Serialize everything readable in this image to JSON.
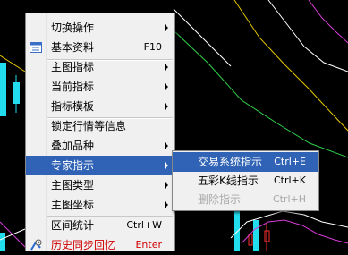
{
  "colors": {
    "background": "#000000",
    "menu_bg": "#f0f0f0",
    "highlight": "#3063b5",
    "alert_text": "#d00000",
    "disabled_text": "#a8a8a8",
    "candle_up": "#22ddee",
    "price_line": "#ffffff",
    "ma_yellow": "#e6c800",
    "ma_green": "#2fd24a",
    "ma_magenta": "#d73cd7"
  },
  "main_menu": {
    "items": [
      {
        "label": "切换操作",
        "shortcut": "",
        "submenu": true
      },
      {
        "label": "基本资料",
        "shortcut": "F10",
        "submenu": false,
        "icon": "info-sheet-icon"
      },
      {
        "label": "主图指标",
        "shortcut": "",
        "submenu": true
      },
      {
        "label": "当前指标",
        "shortcut": "",
        "submenu": true
      },
      {
        "label": "指标模板",
        "shortcut": "",
        "submenu": true
      },
      {
        "label": "锁定行情等信息",
        "shortcut": "",
        "submenu": false
      },
      {
        "label": "叠加品种",
        "shortcut": "",
        "submenu": true
      },
      {
        "label": "专家指示",
        "shortcut": "",
        "submenu": true,
        "highlighted": true
      },
      {
        "label": "主图类型",
        "shortcut": "",
        "submenu": true
      },
      {
        "label": "主图坐标",
        "shortcut": "",
        "submenu": true
      },
      {
        "label": "区间统计",
        "shortcut": "Ctrl+W",
        "submenu": false
      },
      {
        "label": "历史同步回忆",
        "shortcut": "Enter",
        "submenu": false,
        "icon": "history-replay-icon"
      }
    ]
  },
  "expert_submenu": {
    "items": [
      {
        "label": "交易系统指示",
        "shortcut": "Ctrl+E",
        "highlighted": true
      },
      {
        "label": "五彩K线指示",
        "shortcut": "Ctrl+K"
      },
      {
        "label": "删除指示",
        "shortcut": "Ctrl+H",
        "disabled": true
      }
    ]
  }
}
